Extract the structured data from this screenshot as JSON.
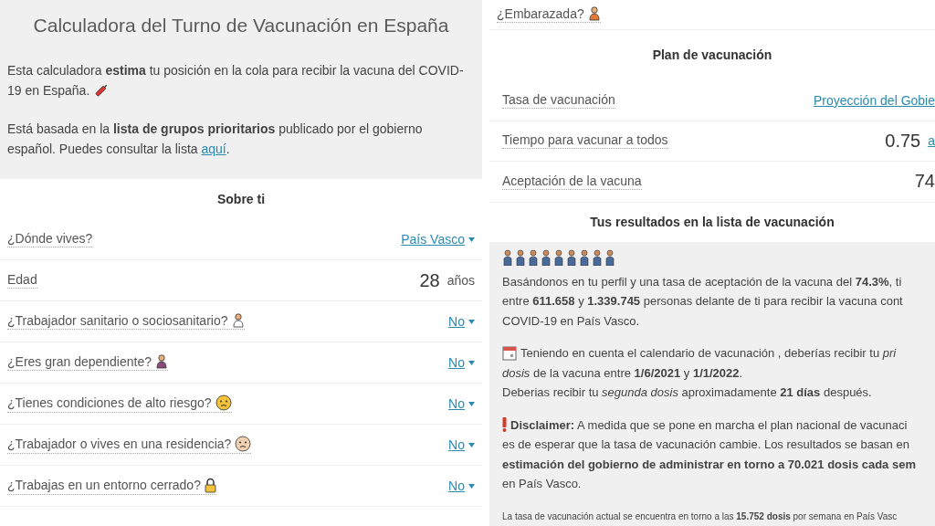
{
  "title": "Calculadora del Turno de Vacunación en España",
  "intro": [
    {
      "lines": [
        "Esta calculadora **estima** tu posición en la cola para recibir la vacuna del COVID-",
        "19 en España."
      ]
    },
    {
      "lines": [
        "Está basada en la **lista de grupos prioritarios** publicado por el gobierno",
        "español. Puedes consultar la lista"
      ],
      "link": "aquí",
      "after": "."
    }
  ],
  "about": {
    "heading": "Sobre ti",
    "rows": [
      {
        "kind": "select",
        "label": "¿Dónde vives?",
        "value": "País Vasco"
      },
      {
        "kind": "number",
        "label": "Edad",
        "value": "28",
        "unit": "años"
      },
      {
        "kind": "select",
        "label": "¿Trabajador sanitario o sociosanitario?",
        "value": "No"
      },
      {
        "kind": "select",
        "label": "¿Eres gran dependiente?",
        "value": "No"
      },
      {
        "kind": "select",
        "label": "¿Tienes condiciones de alto riesgo?",
        "value": "No"
      },
      {
        "kind": "select",
        "label": "¿Trabajador o vives en una residencia?",
        "value": "No"
      },
      {
        "kind": "select",
        "label": "¿Trabajas en un entorno cerrado?",
        "value": "No"
      }
    ]
  },
  "pregnant_row": {
    "label": "¿Embarazada?"
  },
  "plan": {
    "heading": "Plan de vacunación",
    "rows": [
      {
        "kind": "link",
        "label": "Tasa de vacunación",
        "value": "Proyección del Gobie"
      },
      {
        "kind": "number",
        "label": "Tiempo para vacunar a todos",
        "value": "0.75",
        "unit": "a"
      },
      {
        "kind": "number",
        "label": "Aceptación de la vacuna",
        "value": "74"
      }
    ]
  },
  "results": {
    "heading": "Tus resultados en la lista de vacunación",
    "paragraphs": [
      {
        "kind": "plain",
        "lines": [
          "Basándonos en tu perfil y una tasa de aceptación de la vacuna del **74.3%**, ti",
          "entre **611.658** y **1.339.745** personas delante de ti para recibir la vacuna cont",
          "COVID-19 en País Vasco."
        ]
      },
      {
        "kind": "calendar",
        "lines": [
          "Teniendo en cuenta el calendario de vacunación , deberías recibir tu *pri*",
          "*dosis* de la vacuna entre **1/6/2021** y **1/1/2022**.",
          "Deberias recibir tu *segunda dosis* aproximadamente **21 días** después."
        ]
      },
      {
        "kind": "warning",
        "lines": [
          "**Disclaimer:** A medida que se pone en marcha el plan nacional de vacunaci",
          "es de esperar que la tasa de vacunación cambie. Los resultados se basan en",
          "**estimación del gobierno de administrar en torno a 70.021 dosis cada sem**",
          "en País Vasco."
        ]
      }
    ],
    "footnote": "La tasa de vacunación actual se encuentra en torno a las **15.752 dosis** por semana en País Vasc"
  }
}
